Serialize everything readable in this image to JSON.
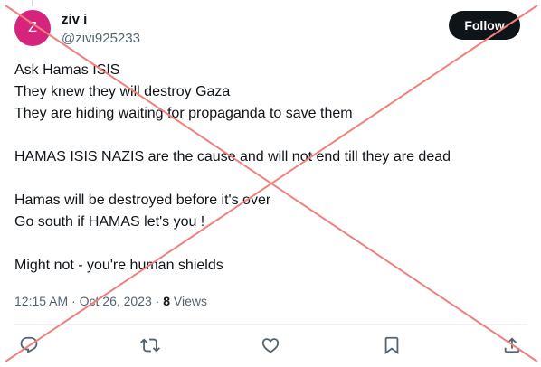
{
  "author": {
    "avatar_letter": "Z",
    "avatar_color": "#d6247c",
    "display_name": "ziv i",
    "handle": "@zivi925233"
  },
  "follow_label": "Follow",
  "tweet_lines": [
    "Ask Hamas ISIS",
    "They knew they will destroy Gaza",
    "They are hiding waiting for propaganda to save them",
    "",
    "HAMAS ISIS NAZIS are the cause and will not end till they are dead",
    "",
    "Hamas will be destroyed before it's over",
    "Go south if HAMAS let's you !",
    "",
    "Might not - you're human shields"
  ],
  "meta": {
    "time": "12:15 AM",
    "separator": " · ",
    "date": "Oct 26, 2023",
    "views_count": "8",
    "views_label": "Views"
  },
  "actions": [
    "reply-icon",
    "retweet-icon",
    "like-icon",
    "bookmark-icon",
    "share-icon"
  ],
  "colors": {
    "overlay_x": "#f08080",
    "secondary_text": "#536471",
    "button_bg": "#0f1419"
  }
}
